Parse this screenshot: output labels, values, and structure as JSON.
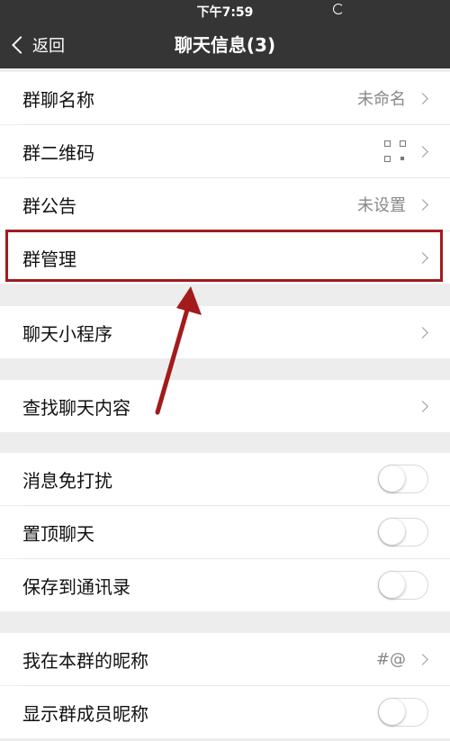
{
  "statusbar": {
    "time": "下午7:59"
  },
  "navbar": {
    "back_label": "返回",
    "title": "聊天信息(3)"
  },
  "rows": {
    "group_name": {
      "label": "群聊名称",
      "value": "未命名"
    },
    "qr_code": {
      "label": "群二维码"
    },
    "announcement": {
      "label": "群公告",
      "value": "未设置"
    },
    "group_manage": {
      "label": "群管理"
    },
    "mini_programs": {
      "label": "聊天小程序"
    },
    "search_content": {
      "label": "查找聊天内容"
    },
    "mute": {
      "label": "消息免打扰",
      "on": false
    },
    "pin": {
      "label": "置顶聊天",
      "on": false
    },
    "save_contacts": {
      "label": "保存到通讯录",
      "on": false
    },
    "my_nickname": {
      "label": "我在本群的昵称",
      "value": "#@"
    },
    "show_nicknames": {
      "label": "显示群成员昵称",
      "on": false
    }
  },
  "annotation": {
    "highlight_color": "#a31b1b"
  }
}
